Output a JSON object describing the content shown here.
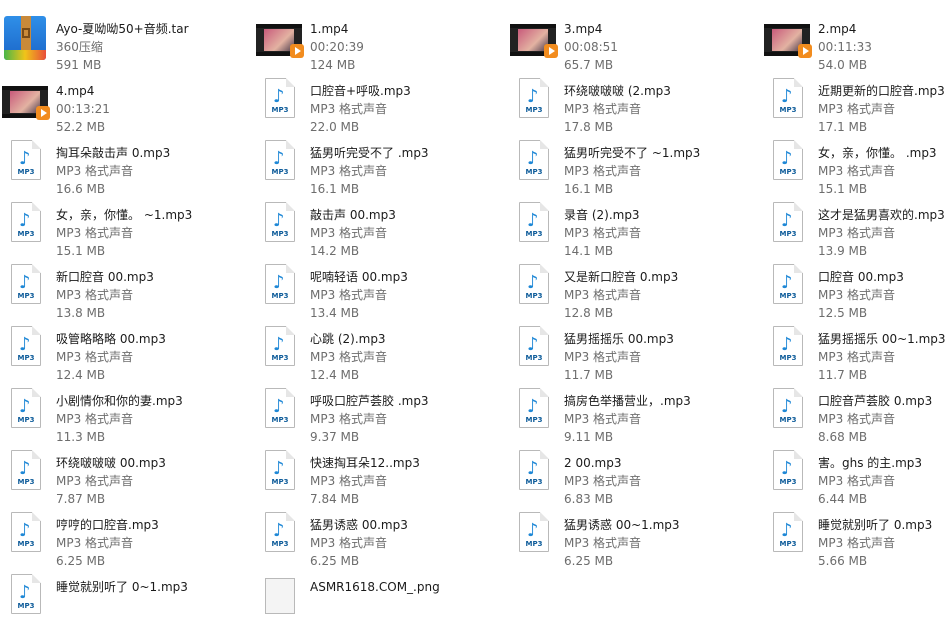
{
  "files": [
    {
      "name": "Ayo-夏呦呦50+音频.tar",
      "line2": "360压缩",
      "line3": "591 MB",
      "icon": "archive-icon"
    },
    {
      "name": "1.mp4",
      "line2": "00:20:39",
      "line3": "124 MB",
      "icon": "video-icon"
    },
    {
      "name": "3.mp4",
      "line2": "00:08:51",
      "line3": "65.7 MB",
      "icon": "video-icon"
    },
    {
      "name": "2.mp4",
      "line2": "00:11:33",
      "line3": "54.0 MB",
      "icon": "video-icon"
    },
    {
      "name": "4.mp4",
      "line2": "00:13:21",
      "line3": "52.2 MB",
      "icon": "video-icon"
    },
    {
      "name": "口腔音+呼吸.mp3",
      "line2": "MP3 格式声音",
      "line3": "22.0 MB",
      "icon": "mp3-file-icon"
    },
    {
      "name": "环绕啵啵啵 (2.mp3",
      "line2": "MP3 格式声音",
      "line3": "17.8 MB",
      "icon": "mp3-file-icon"
    },
    {
      "name": "近期更新的口腔音.mp3",
      "line2": "MP3 格式声音",
      "line3": "17.1 MB",
      "icon": "mp3-file-icon"
    },
    {
      "name": "掏耳朵敲击声 0.mp3",
      "line2": "MP3 格式声音",
      "line3": "16.6 MB",
      "icon": "mp3-file-icon"
    },
    {
      "name": "猛男听完受不了 .mp3",
      "line2": "MP3 格式声音",
      "line3": "16.1 MB",
      "icon": "mp3-file-icon"
    },
    {
      "name": "猛男听完受不了 ~1.mp3",
      "line2": "MP3 格式声音",
      "line3": "16.1 MB",
      "icon": "mp3-file-icon"
    },
    {
      "name": "女，亲，你懂。 .mp3",
      "line2": "MP3 格式声音",
      "line3": "15.1 MB",
      "icon": "mp3-file-icon"
    },
    {
      "name": "女，亲，你懂。 ~1.mp3",
      "line2": "MP3 格式声音",
      "line3": "15.1 MB",
      "icon": "mp3-file-icon"
    },
    {
      "name": "敲击声 00.mp3",
      "line2": "MP3 格式声音",
      "line3": "14.2 MB",
      "icon": "mp3-file-icon"
    },
    {
      "name": "录音 (2).mp3",
      "line2": "MP3 格式声音",
      "line3": "14.1 MB",
      "icon": "mp3-file-icon"
    },
    {
      "name": "这才是猛男喜欢的.mp3",
      "line2": "MP3 格式声音",
      "line3": "13.9 MB",
      "icon": "mp3-file-icon"
    },
    {
      "name": "新口腔音 00.mp3",
      "line2": "MP3 格式声音",
      "line3": "13.8 MB",
      "icon": "mp3-file-icon"
    },
    {
      "name": "呢喃轻语 00.mp3",
      "line2": "MP3 格式声音",
      "line3": "13.4 MB",
      "icon": "mp3-file-icon"
    },
    {
      "name": "又是新口腔音 0.mp3",
      "line2": "MP3 格式声音",
      "line3": "12.8 MB",
      "icon": "mp3-file-icon"
    },
    {
      "name": "口腔音 00.mp3",
      "line2": "MP3 格式声音",
      "line3": "12.5 MB",
      "icon": "mp3-file-icon"
    },
    {
      "name": "吸管略略略 00.mp3",
      "line2": "MP3 格式声音",
      "line3": "12.4 MB",
      "icon": "mp3-file-icon"
    },
    {
      "name": "心跳 (2).mp3",
      "line2": "MP3 格式声音",
      "line3": "12.4 MB",
      "icon": "mp3-file-icon"
    },
    {
      "name": "猛男摇摇乐 00.mp3",
      "line2": "MP3 格式声音",
      "line3": "11.7 MB",
      "icon": "mp3-file-icon"
    },
    {
      "name": "猛男摇摇乐 00~1.mp3",
      "line2": "MP3 格式声音",
      "line3": "11.7 MB",
      "icon": "mp3-file-icon"
    },
    {
      "name": "小剧情你和你的妻.mp3",
      "line2": "MP3 格式声音",
      "line3": "11.3 MB",
      "icon": "mp3-file-icon"
    },
    {
      "name": "呼吸口腔芦荟胶 .mp3",
      "line2": "MP3 格式声音",
      "line3": "9.37 MB",
      "icon": "mp3-file-icon"
    },
    {
      "name": "搞房色举播营业，.mp3",
      "line2": "MP3 格式声音",
      "line3": "9.11 MB",
      "icon": "mp3-file-icon"
    },
    {
      "name": "口腔音芦荟胶 0.mp3",
      "line2": "MP3 格式声音",
      "line3": "8.68 MB",
      "icon": "mp3-file-icon"
    },
    {
      "name": "环绕啵啵啵 00.mp3",
      "line2": "MP3 格式声音",
      "line3": "7.87 MB",
      "icon": "mp3-file-icon"
    },
    {
      "name": "快速掏耳朵12..mp3",
      "line2": "MP3 格式声音",
      "line3": "7.84 MB",
      "icon": "mp3-file-icon"
    },
    {
      "name": "2 00.mp3",
      "line2": "MP3 格式声音",
      "line3": "6.83 MB",
      "icon": "mp3-file-icon"
    },
    {
      "name": "害。ghs 的主.mp3",
      "line2": "MP3 格式声音",
      "line3": "6.44 MB",
      "icon": "mp3-file-icon"
    },
    {
      "name": "哼哼的口腔音.mp3",
      "line2": "MP3 格式声音",
      "line3": "6.25 MB",
      "icon": "mp3-file-icon"
    },
    {
      "name": "猛男诱惑 00.mp3",
      "line2": "MP3 格式声音",
      "line3": "6.25 MB",
      "icon": "mp3-file-icon"
    },
    {
      "name": "猛男诱惑 00~1.mp3",
      "line2": "MP3 格式声音",
      "line3": "6.25 MB",
      "icon": "mp3-file-icon"
    },
    {
      "name": "睡觉就别听了 0.mp3",
      "line2": "MP3 格式声音",
      "line3": "5.66 MB",
      "icon": "mp3-file-icon"
    },
    {
      "name": "睡觉就别听了 0~1.mp3",
      "line2": "",
      "line3": "",
      "icon": "mp3-file-icon"
    },
    {
      "name": "ASMR1618.COM_.png",
      "line2": "",
      "line3": "",
      "icon": "png-image-icon"
    }
  ],
  "mp3_ext_label": "MP3"
}
